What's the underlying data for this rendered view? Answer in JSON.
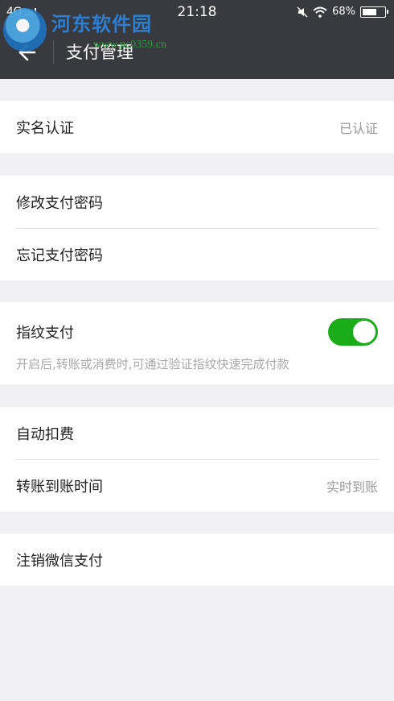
{
  "status_bar": {
    "network": "4G",
    "time": "21:18",
    "battery": "68%",
    "battery_level": 0.68
  },
  "watermark": {
    "name": "河东软件园",
    "url": "www.pc0359.cn"
  },
  "header": {
    "title": "支付管理"
  },
  "sections": {
    "real_name": {
      "label": "实名认证",
      "value": "已认证"
    },
    "password": {
      "change_label": "修改支付密码",
      "forgot_label": "忘记支付密码"
    },
    "fingerprint": {
      "label": "指纹支付",
      "enabled": true,
      "description": "开启后,转账或消费时,可通过验证指纹快速完成付款"
    },
    "auto": {
      "auto_deduct_label": "自动扣费",
      "transfer_time_label": "转账到账时间",
      "transfer_time_value": "实时到账"
    },
    "cancel": {
      "label": "注销微信支付"
    }
  },
  "colors": {
    "nav_bg": "#393a3f",
    "page_bg": "#efeff4",
    "toggle_on": "#1aad19"
  }
}
